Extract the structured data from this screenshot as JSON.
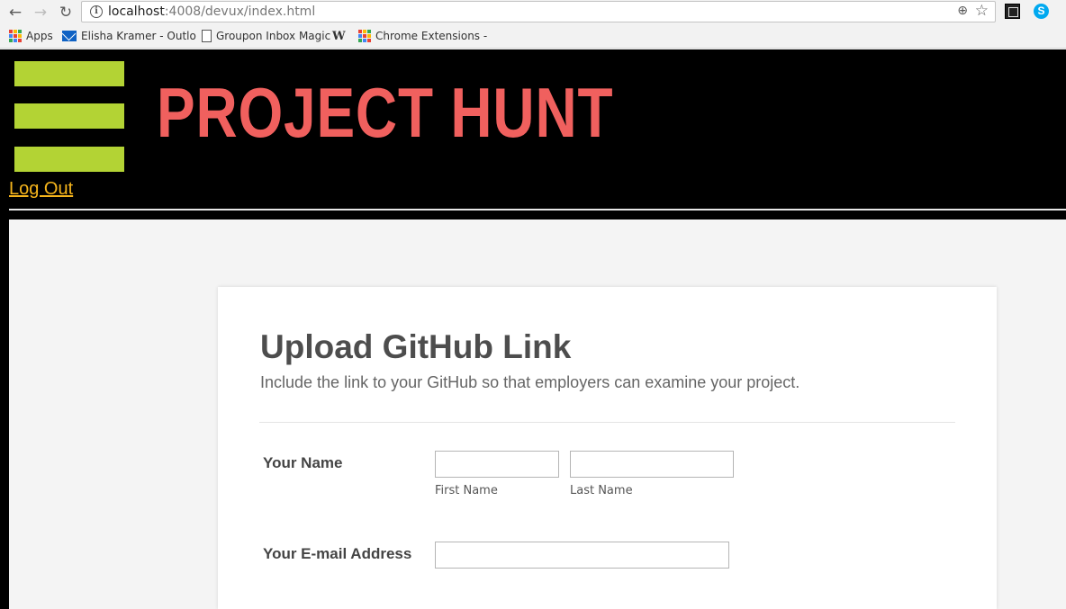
{
  "browser": {
    "url_host": "localhost",
    "url_path": ":4008/devux/index.html",
    "bookmarks": [
      {
        "label": "Apps"
      },
      {
        "label": "Elisha Kramer - Outlo"
      },
      {
        "label": "Groupon Inbox Magic"
      },
      {
        "label": "W"
      },
      {
        "label": "Chrome Extensions - "
      }
    ]
  },
  "header": {
    "brand": "PROJECT HUNT",
    "logout_label": "Log Out",
    "colors": {
      "brand": "#f0605e",
      "menu": "#b3d334",
      "link": "#f6b51c"
    }
  },
  "form": {
    "title": "Upload GitHub Link",
    "subtitle": "Include the link to your GitHub so that employers can examine your project.",
    "name_label": "Your Name",
    "first_name_value": "",
    "first_name_sublabel": "First Name",
    "last_name_value": "",
    "last_name_sublabel": "Last Name",
    "email_label": "Your E-mail Address",
    "email_value": ""
  }
}
